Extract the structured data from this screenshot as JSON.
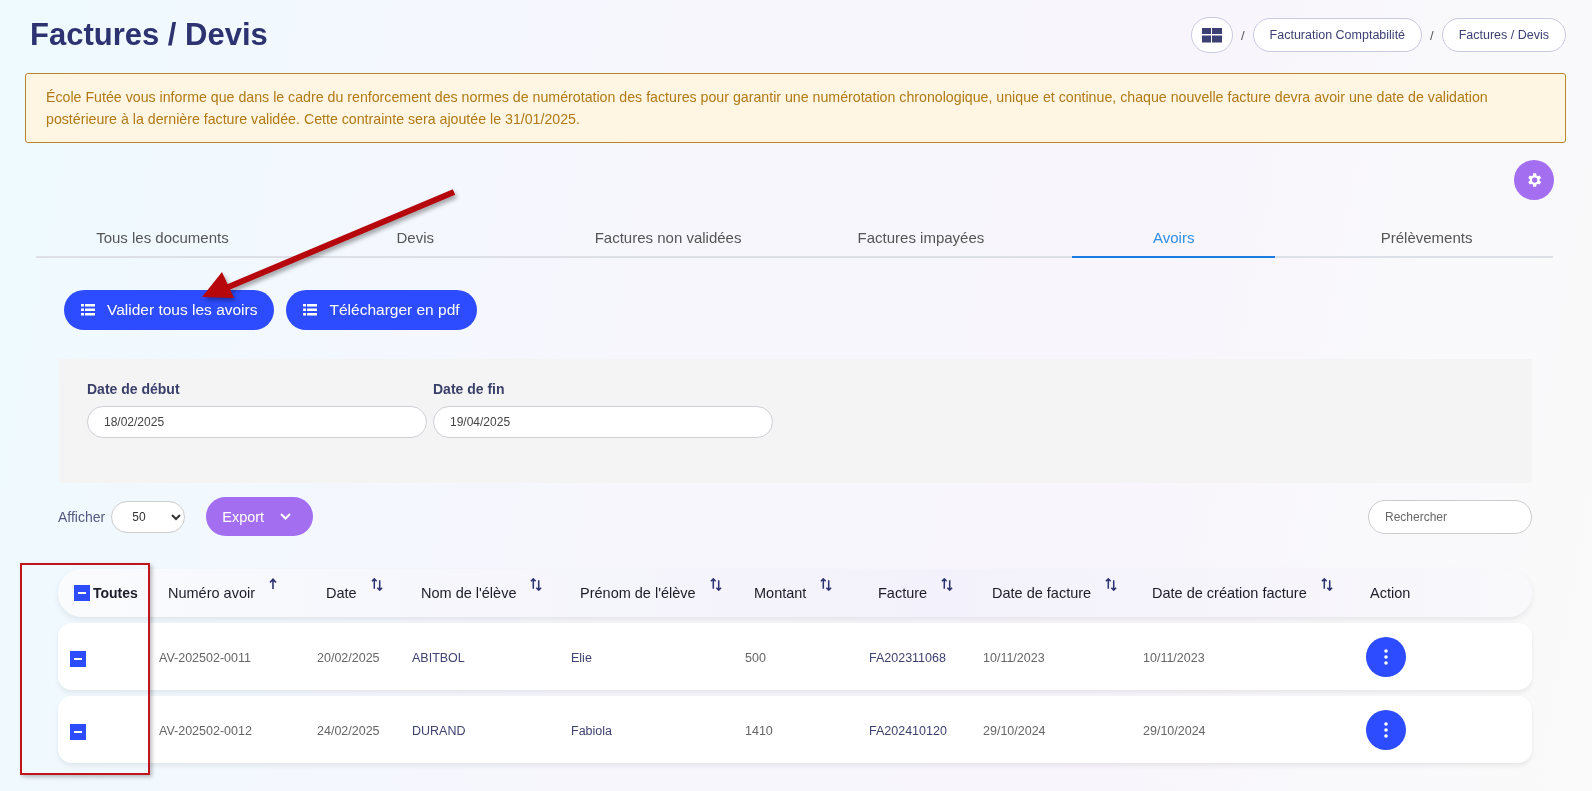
{
  "page_title": "Factures / Devis",
  "breadcrumb": {
    "items": [
      "Facturation Comptabilité",
      "Factures / Devis"
    ],
    "separator": "/"
  },
  "notice": "École Futée vous informe que dans le cadre du renforcement des normes de numérotation des factures pour garantir une numérotation chronologique, unique et continue, chaque nouvelle facture devra avoir une date de validation postérieure à la dernière facture validée. Cette contrainte sera ajoutée le 31/01/2025.",
  "tabs": [
    {
      "label": "Tous les documents",
      "selected": false
    },
    {
      "label": "Devis",
      "selected": false
    },
    {
      "label": "Factures non validées",
      "selected": false
    },
    {
      "label": "Factures impayées",
      "selected": false
    },
    {
      "label": "Avoirs",
      "selected": true
    },
    {
      "label": "Prélèvements",
      "selected": false
    }
  ],
  "actions": [
    "Valider tous les avoirs",
    "Télécharger en pdf"
  ],
  "filters": [
    {
      "label": "Date de début",
      "value": "18/02/2025"
    },
    {
      "label": "Date de fin",
      "value": "19/04/2025"
    }
  ],
  "page_size": {
    "label": "Afficher",
    "value": "50"
  },
  "export_button": "Export",
  "search": {
    "placeholder": "Rechercher"
  },
  "table": {
    "select_all": {
      "label": "Toutes",
      "checked": true
    },
    "columns": [
      {
        "label": "Numéro avoir",
        "sortable": true,
        "sorted": true
      },
      {
        "label": "Date",
        "sortable": true,
        "sorted": false
      },
      {
        "label": "Nom de l'élève",
        "sortable": true,
        "sorted": false
      },
      {
        "label": "Prénom de l'élève",
        "sortable": true,
        "sorted": false
      },
      {
        "label": "Montant",
        "sortable": true,
        "sorted": false
      },
      {
        "label": "Facture",
        "sortable": true,
        "sorted": false
      },
      {
        "label": "Date de facture",
        "sortable": true,
        "sorted": false
      },
      {
        "label": "Date de création facture",
        "sortable": true,
        "sorted": false
      },
      {
        "label": "Action",
        "sortable": false
      }
    ],
    "rows": [
      {
        "checked": true,
        "cells": [
          "AV-202502-0011",
          "20/02/2025",
          "ABITBOL",
          "Elie",
          "500",
          "FA202311068",
          "10/11/2023",
          "10/11/2023"
        ]
      },
      {
        "checked": true,
        "cells": [
          "AV-202502-0012",
          "24/02/2025",
          "DURAND",
          "Fabiola",
          "1410",
          "FA202410120",
          "29/10/2024",
          "29/10/2024"
        ]
      }
    ]
  }
}
